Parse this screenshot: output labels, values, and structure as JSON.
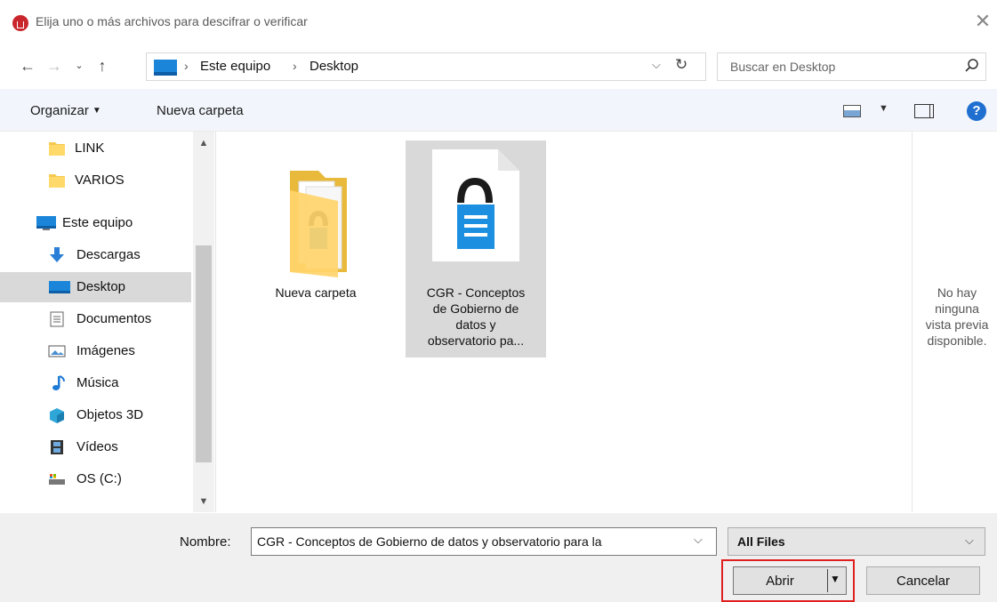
{
  "window": {
    "title": "Elija uno o más archivos para descifrar o verificar",
    "app_icon": "app-logo-icon",
    "close_icon": "close-icon"
  },
  "navigation": {
    "back_icon": "back-arrow-icon",
    "forward_icon": "forward-arrow-icon",
    "recent_icon": "chevron-down-icon",
    "up_icon": "up-arrow-icon",
    "breadcrumb": [
      "Este equipo",
      "Desktop"
    ],
    "refresh_icon": "refresh-icon",
    "search_placeholder": "Buscar en Desktop"
  },
  "toolbar": {
    "organize_label": "Organizar",
    "new_folder_label": "Nueva carpeta"
  },
  "sidebar": {
    "items": [
      {
        "label": "LINK",
        "icon": "folder-icon",
        "selected": false
      },
      {
        "label": "VARIOS",
        "icon": "folder-icon",
        "selected": false
      },
      {
        "label": "Este equipo",
        "icon": "computer-icon",
        "selected": false
      },
      {
        "label": "Descargas",
        "icon": "download-icon",
        "selected": false
      },
      {
        "label": "Desktop",
        "icon": "desktop-icon",
        "selected": true
      },
      {
        "label": "Documentos",
        "icon": "documents-icon",
        "selected": false
      },
      {
        "label": "Imágenes",
        "icon": "pictures-icon",
        "selected": false
      },
      {
        "label": "Música",
        "icon": "music-icon",
        "selected": false
      },
      {
        "label": "Objetos 3D",
        "icon": "cube-icon",
        "selected": false
      },
      {
        "label": "Vídeos",
        "icon": "film-icon",
        "selected": false
      },
      {
        "label": "OS (C:)",
        "icon": "drive-icon",
        "selected": false
      }
    ]
  },
  "files": [
    {
      "name_lines": [
        "Nueva carpeta"
      ],
      "type": "folder",
      "selected": false
    },
    {
      "name_lines": [
        "CGR - Conceptos",
        "de Gobierno de",
        "datos y",
        "observatorio pa..."
      ],
      "type": "encrypted-file",
      "selected": true
    }
  ],
  "preview": {
    "lines": [
      "No hay",
      "ninguna",
      "vista previa",
      "disponible."
    ]
  },
  "footer": {
    "name_label": "Nombre:",
    "name_value": "CGR - Conceptos de Gobierno de datos y observatorio para la",
    "filter_value": "All Files",
    "open_label": "Abrir",
    "cancel_label": "Cancelar"
  },
  "colors": {
    "accent": "#1b86d9",
    "highlight": "#e02020",
    "selection": "#d9d9d9",
    "toolbar_bg": "#f2f5fb"
  }
}
